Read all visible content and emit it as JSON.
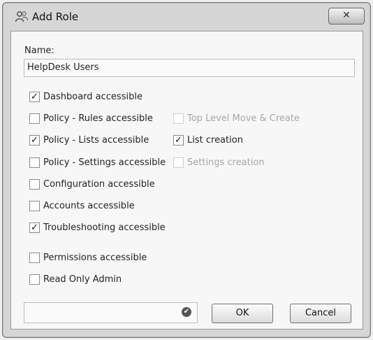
{
  "window": {
    "title": "Add Role",
    "close_label": "✕"
  },
  "form": {
    "name_label": "Name:",
    "name_value": "HelpDesk Users"
  },
  "permissions": [
    {
      "label": "Dashboard accessible",
      "checked": true,
      "enabled": true
    },
    {
      "label": "Policy - Rules accessible",
      "checked": false,
      "enabled": true
    },
    {
      "label": "Policy - Lists accessible",
      "checked": true,
      "enabled": true
    },
    {
      "label": "Policy - Settings accessible",
      "checked": false,
      "enabled": true
    },
    {
      "label": "Configuration accessible",
      "checked": false,
      "enabled": true
    },
    {
      "label": "Accounts accessible",
      "checked": false,
      "enabled": true
    },
    {
      "label": "Troubleshooting accessible",
      "checked": true,
      "enabled": true
    },
    {
      "label": "Permissions accessible",
      "checked": false,
      "enabled": true
    },
    {
      "label": "Read Only Admin",
      "checked": false,
      "enabled": true
    }
  ],
  "sub_permissions": [
    {
      "label": "Top Level Move & Create",
      "checked": false,
      "enabled": false
    },
    {
      "label": "List creation",
      "checked": true,
      "enabled": true
    },
    {
      "label": "Settings creation",
      "checked": false,
      "enabled": false
    }
  ],
  "footer": {
    "status_icon": "check-circle-icon",
    "ok_label": "OK",
    "cancel_label": "Cancel"
  }
}
